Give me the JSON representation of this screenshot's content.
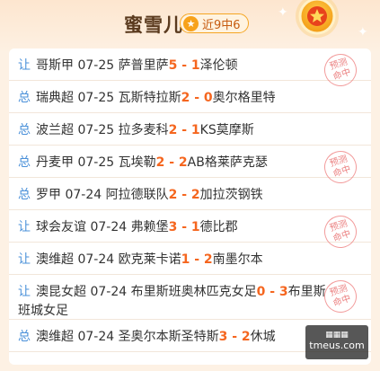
{
  "header": {
    "title": "蜜雪儿",
    "record_badge": "近9中6",
    "star_glyph": "★"
  },
  "stamp": {
    "line1": "预测",
    "line2": "命中"
  },
  "matches": [
    {
      "type": "让",
      "league": "哥斯甲",
      "date": "07-25",
      "home": "萨普里萨",
      "home_score": "5",
      "sep": " - ",
      "away_score": "1",
      "away": "泽伦顿",
      "hit": true
    },
    {
      "type": "总",
      "league": "瑞典超",
      "date": "07-25",
      "home": "瓦斯特拉斯",
      "home_score": "2",
      "sep": " - ",
      "away_score": "0",
      "away": "奥尔格里特",
      "hit": false
    },
    {
      "type": "总",
      "league": "波兰超",
      "date": "07-25",
      "home": "拉多麦科",
      "home_score": "2",
      "sep": " - ",
      "away_score": "1",
      "away": "KS莫摩斯",
      "hit": false
    },
    {
      "type": "总",
      "league": "丹麦甲",
      "date": "07-25",
      "home": "瓦埃勒",
      "home_score": "2",
      "sep": " - ",
      "away_score": "2",
      "away": "AB格莱萨克瑟",
      "hit": true
    },
    {
      "type": "总",
      "league": "罗甲",
      "date": "07-24",
      "home": "阿拉德联队",
      "home_score": "2",
      "sep": " - ",
      "away_score": "2",
      "away": "加拉茨钢铁",
      "hit": false
    },
    {
      "type": "让",
      "league": "球会友谊",
      "date": "07-24",
      "home": "弗赖堡",
      "home_score": "3",
      "sep": " - ",
      "away_score": "1",
      "away": "德比郡",
      "hit": true
    },
    {
      "type": "让",
      "league": "澳维超",
      "date": "07-24",
      "home": "欧克莱卡诺",
      "home_score": "1",
      "sep": " - ",
      "away_score": "2",
      "away": "南墨尔本",
      "hit": false
    },
    {
      "type": "让",
      "league": "澳昆女超",
      "date": "07-24",
      "home": "布里斯班奥林匹克女足",
      "home_score": "0",
      "sep": " - ",
      "away_score": "3",
      "away": "布里斯班城女足",
      "hit": true
    },
    {
      "type": "总",
      "league": "澳维超",
      "date": "07-24",
      "home": "圣奥尔本斯圣特斯",
      "home_score": "3",
      "sep": " - ",
      "away_score": "2",
      "away": "休城",
      "hit": false
    }
  ],
  "watermark": {
    "top": "▦▦▦",
    "bottom": "tmeus.com"
  },
  "colors": {
    "accent": "#f5661f",
    "type_label": "#4a90d9",
    "stamp": "#e86a6a"
  }
}
